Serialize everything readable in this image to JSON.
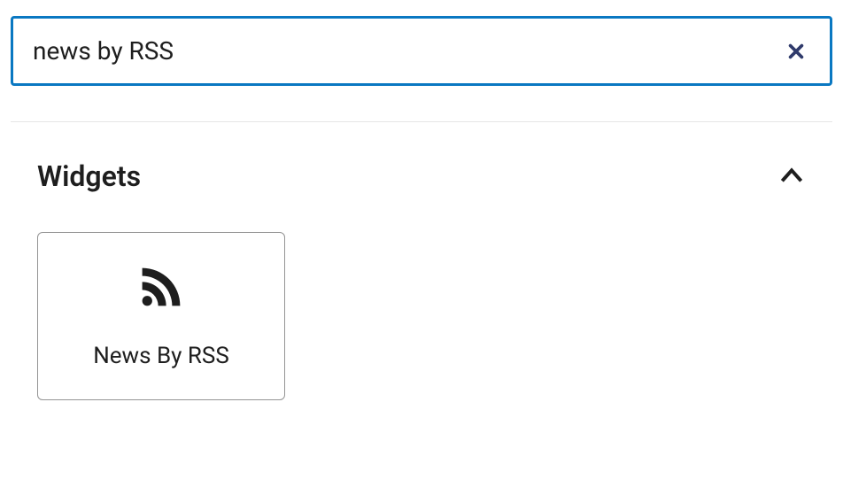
{
  "search": {
    "value": "news by RSS"
  },
  "section": {
    "title": "Widgets"
  },
  "widgets": [
    {
      "label": "News By RSS"
    }
  ]
}
